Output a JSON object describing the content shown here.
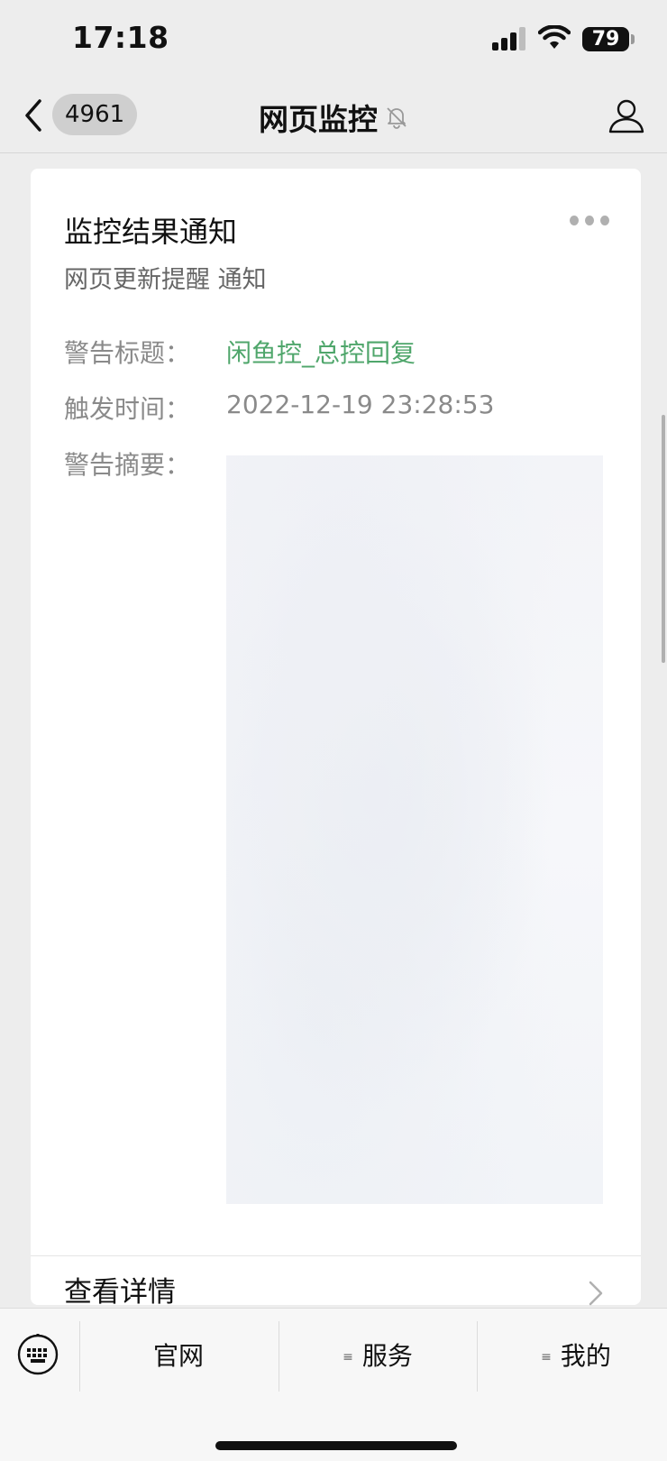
{
  "status_bar": {
    "time": "17:18",
    "battery": "79"
  },
  "nav": {
    "unread_badge": "4961",
    "title": "网页监控",
    "title_icon": "bell-off-icon",
    "right_icon": "profile-icon"
  },
  "message": {
    "title": "监控结果通知",
    "subtitle": "网页更新提醒 通知",
    "fields": [
      {
        "label": "警告标题：",
        "value": "闲鱼控_总控回复"
      },
      {
        "label": "触发时间：",
        "value": "2022-12-19 23:28:53"
      },
      {
        "label": "警告摘要：",
        "value": ""
      }
    ],
    "details_label": "查看详情"
  },
  "bottom_menu": {
    "items": [
      {
        "label": "官网",
        "has_submenu": false
      },
      {
        "label": "服务",
        "has_submenu": true
      },
      {
        "label": "我的",
        "has_submenu": true
      }
    ]
  },
  "colors": {
    "accent_green": "#4fa66b",
    "background": "#ededed"
  }
}
